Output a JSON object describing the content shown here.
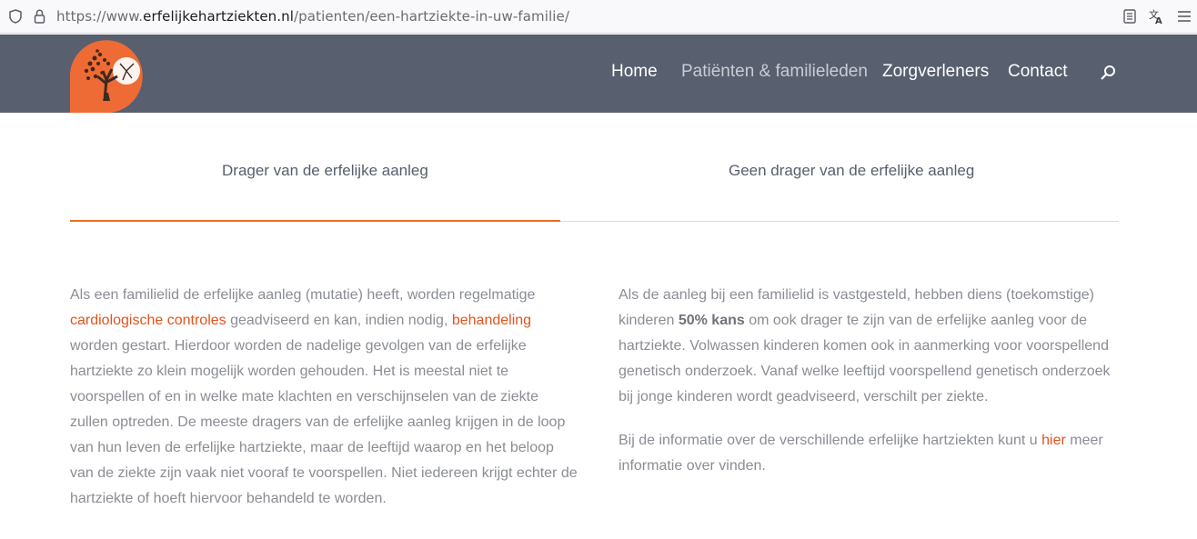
{
  "browser": {
    "url_prefix": "https://www.",
    "url_domain": "erfelijkehartziekten.nl",
    "url_path": "/patienten/een-hartziekte-in-uw-familie/"
  },
  "nav": {
    "items": [
      {
        "label": "Home"
      },
      {
        "label": "Patiënten & familieleden"
      },
      {
        "label": "Zorgverleners"
      },
      {
        "label": "Contact"
      }
    ]
  },
  "tabs": [
    {
      "label": "Drager van de erfelijke aanleg"
    },
    {
      "label": "Geen drager van de erfelijke aanleg"
    }
  ],
  "left": {
    "p1_a": "Als een familielid de erfelijke aanleg (mutatie) heeft, worden regelmatige",
    "link_controles": "cardiologische controles",
    "p1_b": " geadviseerd en kan, indien nodig, ",
    "link_behandeling": "behandeling",
    "p1_c": " worden gestart. Hierdoor worden de nadelige gevolgen van de erfelijke hartziekte zo klein mogelijk worden gehouden. Het is meestal niet te voorspellen of en in welke mate klachten en verschijnselen van de ziekte zullen optreden. De meeste dragers van de erfelijke aanleg krijgen in de loop van hun leven de erfelijke hartziekte, maar de leeftijd waarop en het beloop van de ziekte zijn vaak niet vooraf te voorspellen. Niet iedereen krijgt echter de hartziekte of hoeft hiervoor behandeld te worden."
  },
  "right": {
    "p1_a": "Als de aanleg bij een familielid is vastgesteld, hebben diens (toekomstige) kinderen ",
    "p1_bold": "50% kans",
    "p1_b": " om ook drager te zijn van de erfelijke aanleg voor de hartziekte. Volwassen kinderen komen ook in aanmerking voor voorspellend genetisch onderzoek. Vanaf welke leeftijd voorspellend genetisch onderzoek bij jonge kinderen wordt geadviseerd, verschilt per ziekte.",
    "p2_a": "Bij de informatie over de verschillende erfelijke hartziekten kunt u ",
    "link_hier": "hier",
    "p2_b": " meer informatie over vinden."
  },
  "colors": {
    "header_bg": "#585f6f",
    "accent": "#e8711f",
    "link": "#e1541f",
    "logo_bg": "#ef6b35"
  }
}
